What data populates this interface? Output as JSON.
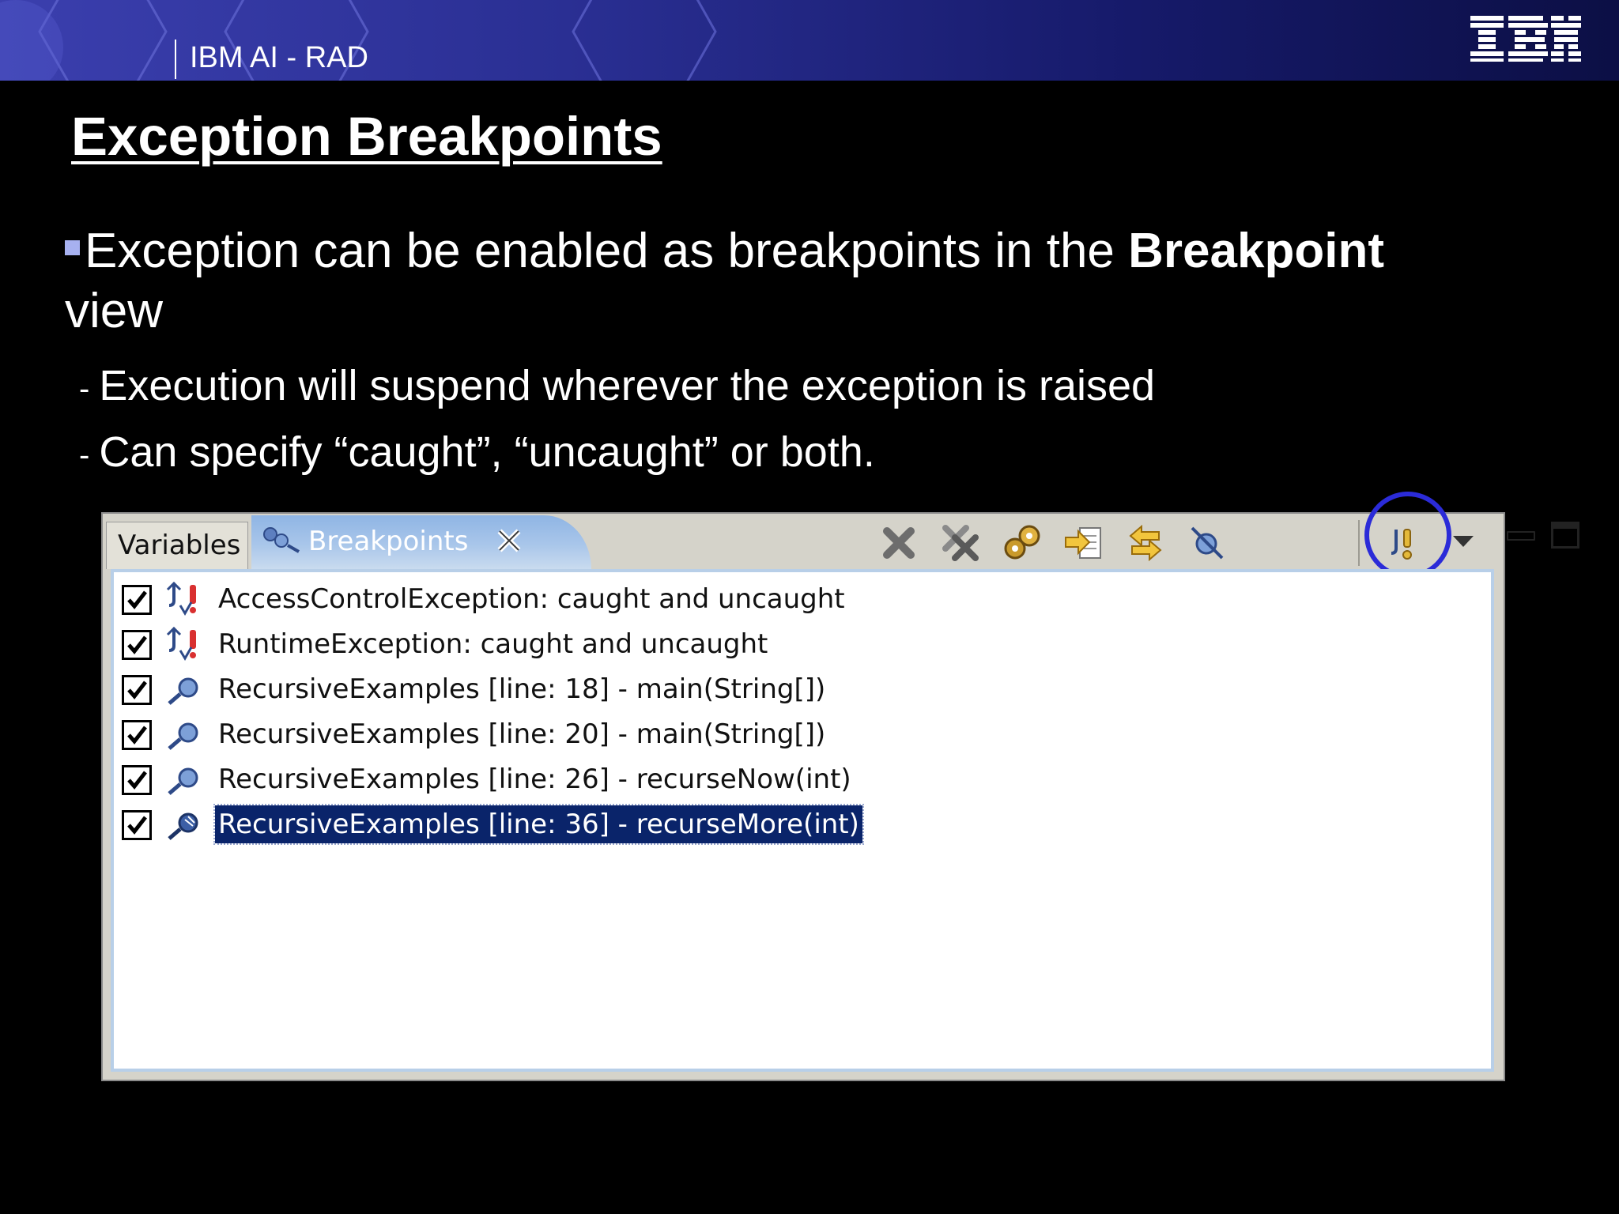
{
  "header": {
    "banner_title": "IBM AI - RAD",
    "logo_text": "IBM"
  },
  "slide": {
    "title": "Exception Breakpoints",
    "bullet_main": "Exception can be enabled as breakpoints in the",
    "bullet_bold": "Breakpoint",
    "bullet_tail": "view",
    "subbullets": [
      "Execution will suspend wherever the exception is raised",
      "Can specify “caught”, “uncaught” or both."
    ],
    "dash": "-"
  },
  "panel": {
    "tabs": [
      {
        "label": "Variables",
        "active": false
      },
      {
        "label": "Breakpoints",
        "active": true
      }
    ],
    "toolbar_icons": [
      "remove-selected-icon",
      "remove-all-icon",
      "show-supported-icon",
      "go-to-file-icon",
      "link-with-debug-icon",
      "skip-all-icon",
      "add-java-exception-breakpoint-icon",
      "view-menu-icon",
      "minimize-icon",
      "maximize-icon"
    ],
    "highlighted_tool": "add-java-exception-breakpoint-icon",
    "breakpoints": [
      {
        "label": "AccessControlException: caught and uncaught",
        "checked": true,
        "icon": "exception-breakpoint-icon",
        "selected": false
      },
      {
        "label": "RuntimeException: caught and uncaught",
        "checked": true,
        "icon": "exception-breakpoint-icon",
        "selected": false
      },
      {
        "label": "RecursiveExamples [line: 18] - main(String[])",
        "checked": true,
        "icon": "line-breakpoint-icon",
        "selected": false
      },
      {
        "label": "RecursiveExamples [line: 20] - main(String[])",
        "checked": true,
        "icon": "line-breakpoint-icon",
        "selected": false
      },
      {
        "label": "RecursiveExamples [line: 26] - recurseNow(int)",
        "checked": true,
        "icon": "line-breakpoint-icon",
        "selected": false
      },
      {
        "label": "RecursiveExamples [line: 36] - recurseMore(int)",
        "checked": true,
        "icon": "line-breakpoint-icon",
        "selected": true
      }
    ]
  },
  "colors": {
    "background": "#000000",
    "banner_start": "#3b3fae",
    "banner_end": "#0c0f45",
    "bullet_square": "#a7b1f0",
    "selection": "#0a246a",
    "highlight_circle": "#2b2bd8"
  }
}
